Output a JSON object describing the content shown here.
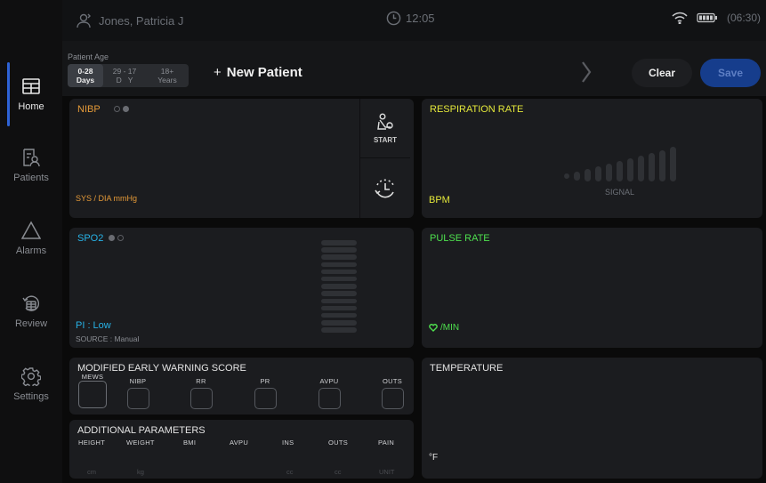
{
  "sidebar": {
    "items": [
      {
        "label": "Home",
        "icon": "home-grid-icon"
      },
      {
        "label": "Patients",
        "icon": "patients-icon"
      },
      {
        "label": "Alarms",
        "icon": "alarm-triangle-icon"
      },
      {
        "label": "Review",
        "icon": "review-history-icon"
      },
      {
        "label": "Settings",
        "icon": "gear-icon"
      }
    ],
    "active": "Home",
    "accent": "#2e63d6"
  },
  "topbar": {
    "user": "Jones, Patricia J",
    "time": "12:05",
    "battery_time": "(06:30)"
  },
  "patient": {
    "age_label": "Patient Age",
    "age_options": [
      {
        "line1": "0-28",
        "line2": "Days",
        "selected": true
      },
      {
        "line1": "29 - 17",
        "line2": "D   Y",
        "selected": false
      },
      {
        "line1": "18+",
        "line2": "Years",
        "selected": false
      }
    ],
    "new_patient_plus": "+",
    "new_patient": "New Patient",
    "clear": "Clear",
    "save": "Save"
  },
  "nibp": {
    "title": "NIBP",
    "unit": "SYS / DIA mmHg",
    "start": "START",
    "color": "#e59a38"
  },
  "respiration": {
    "title": "RESPIRATION RATE",
    "unit": "BPM",
    "signal": "SIGNAL",
    "color": "#e4e83a"
  },
  "spo2": {
    "title": "SPO2",
    "pi": "PI : Low",
    "source": "SOURCE : Manual",
    "color": "#27b2e6"
  },
  "pulse": {
    "title": "PULSE RATE",
    "unit": "/MIN",
    "color": "#4ee04e"
  },
  "mews": {
    "title": "MODIFIED EARLY WARNING SCORE",
    "columns": [
      "MEWS",
      "NIBP",
      "RR",
      "PR",
      "AVPU",
      "OUTS"
    ]
  },
  "temperature": {
    "title": "TEMPERATURE",
    "unit": "°F"
  },
  "additional": {
    "title": "ADDITIONAL PARAMETERS",
    "columns": [
      "HEIGHT",
      "WEIGHT",
      "BMI",
      "AVPU",
      "INS",
      "OUTS",
      "PAIN"
    ],
    "units": [
      "cm",
      "kg",
      "",
      "",
      "cc",
      "cc",
      "UNIT"
    ]
  }
}
